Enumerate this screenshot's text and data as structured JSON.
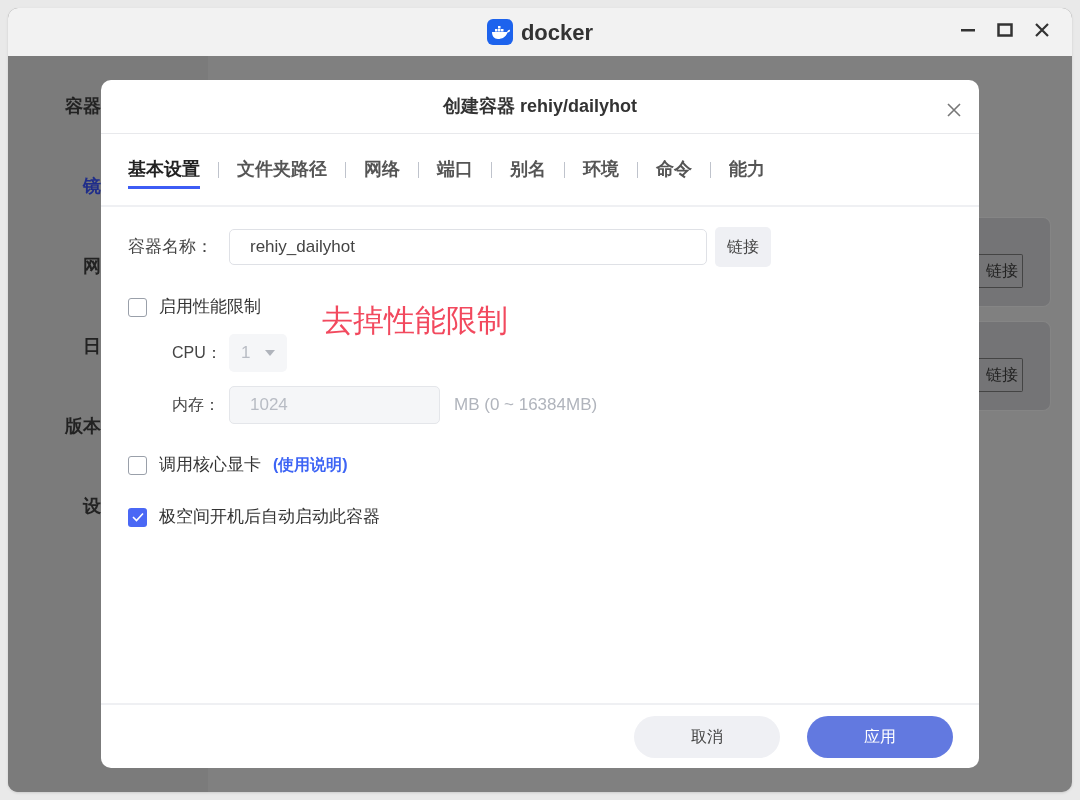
{
  "window": {
    "title": "docker"
  },
  "background": {
    "sidebar_items": [
      {
        "label": "容器",
        "selected": false
      },
      {
        "label": "镜",
        "selected": true
      },
      {
        "label": "网",
        "selected": false
      },
      {
        "label": "日",
        "selected": false
      },
      {
        "label": "版本",
        "selected": false
      },
      {
        "label": "设",
        "selected": false
      }
    ],
    "cards": [
      {
        "button": "链接"
      },
      {
        "button": "链接"
      }
    ]
  },
  "dialog": {
    "title": "创建容器 rehiy/dailyhot",
    "tabs": [
      {
        "label": "基本设置",
        "selected": true
      },
      {
        "label": "文件夹路径",
        "selected": false
      },
      {
        "label": "网络",
        "selected": false
      },
      {
        "label": "端口",
        "selected": false
      },
      {
        "label": "别名",
        "selected": false
      },
      {
        "label": "环境",
        "selected": false
      },
      {
        "label": "命令",
        "selected": false
      },
      {
        "label": "能力",
        "selected": false
      }
    ],
    "name_field": {
      "label": "容器名称：",
      "value": "rehiy_dailyhot",
      "button": "链接"
    },
    "performance_limit": {
      "label": "启用性能限制",
      "checked": false,
      "cpu": {
        "label": "CPU：",
        "value": "1",
        "disabled": true
      },
      "memory": {
        "label": "内存：",
        "value": "1024",
        "hint": "MB (0 ~ 16384MB)",
        "disabled": true
      }
    },
    "options": [
      {
        "label": "调用核心显卡",
        "link": "(使用说明)",
        "checked": false
      },
      {
        "label": "极空间开机后自动启动此容器",
        "checked": true
      }
    ],
    "buttons": [
      {
        "label": "取消",
        "kind": "secondary"
      },
      {
        "label": "应用",
        "kind": "primary"
      }
    ]
  },
  "annotation": {
    "text": "去掉性能限制"
  }
}
